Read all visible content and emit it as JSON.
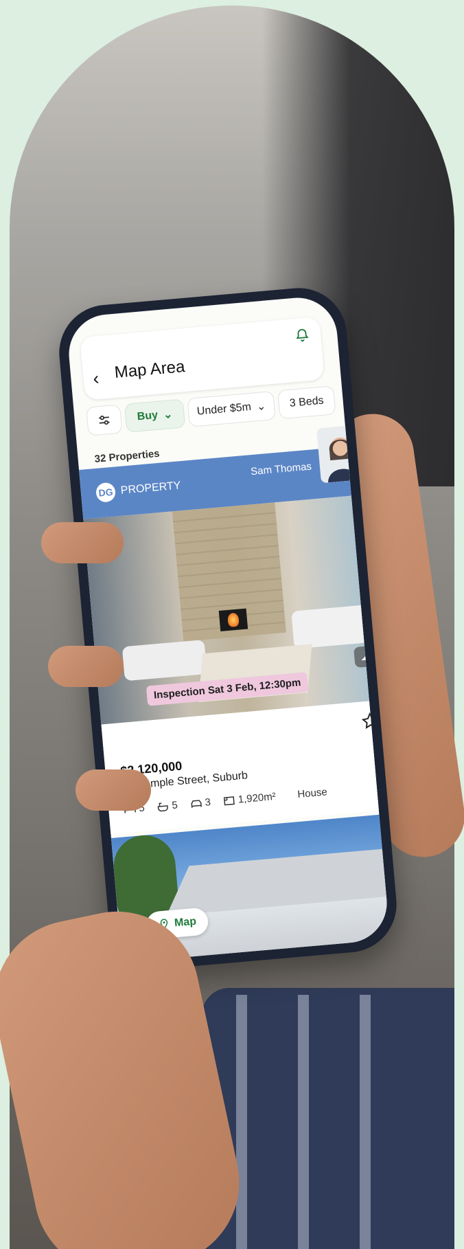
{
  "header": {
    "title": "Map Area"
  },
  "filters": {
    "chips": [
      {
        "label": "Buy"
      },
      {
        "label": "Under $5m"
      },
      {
        "label": "3 Beds"
      }
    ]
  },
  "results": {
    "count_label": "32 Properties"
  },
  "agent": {
    "brand": "PROPERTY",
    "logo_initials": "DG",
    "name": "Sam Thomas",
    "bar_color": "#5b86c6"
  },
  "listing": {
    "inspection": "Inspection Sat 3 Feb, 12:30pm",
    "price": "$2,120,000",
    "address": "24 Sample Street, Suburb",
    "beds": "5",
    "baths": "5",
    "cars": "3",
    "area": "1,920m²",
    "type": "House"
  },
  "map_button": {
    "label": "Map"
  },
  "colors": {
    "accent": "#1f7a3a",
    "background": "#dcefe0"
  }
}
